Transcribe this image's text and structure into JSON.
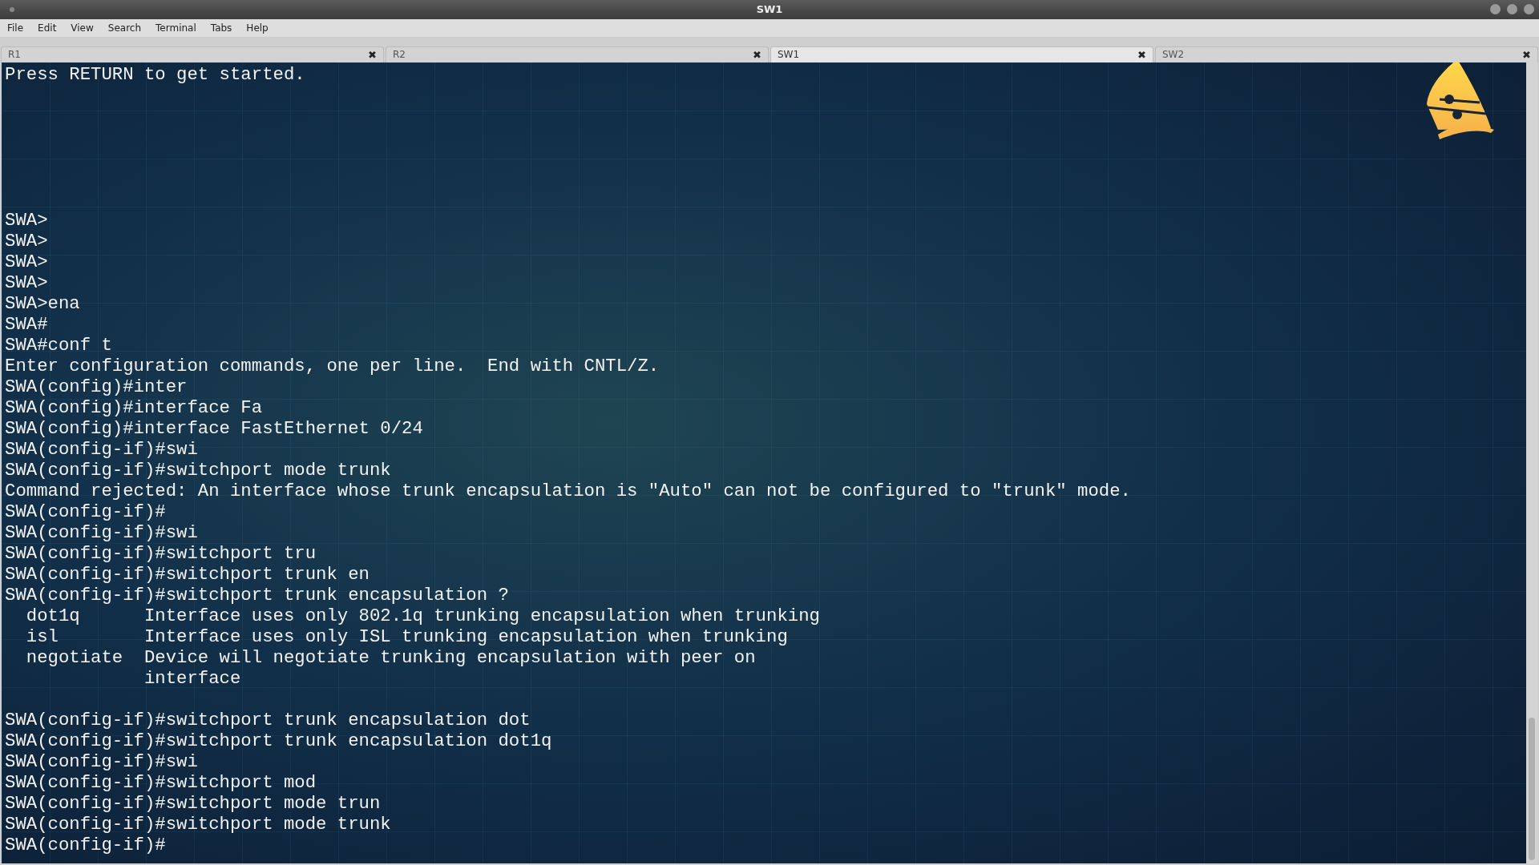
{
  "window": {
    "title": "SW1"
  },
  "menu": [
    "File",
    "Edit",
    "View",
    "Search",
    "Terminal",
    "Tabs",
    "Help"
  ],
  "tabs": [
    {
      "label": "R1",
      "selected": false,
      "close": "✖"
    },
    {
      "label": "R2",
      "selected": false,
      "close": "✖"
    },
    {
      "label": "SW1",
      "selected": true,
      "close": "✖"
    },
    {
      "label": "SW2",
      "selected": false,
      "close": "✖"
    }
  ],
  "terminal": {
    "blocks": [
      [
        "Press RETURN to get started."
      ],
      [
        "SWA>",
        "SWA>",
        "SWA>",
        "SWA>",
        "SWA>ena",
        "SWA#",
        "SWA#conf t",
        "Enter configuration commands, one per line.  End with CNTL/Z.",
        "SWA(config)#inter",
        "SWA(config)#interface Fa",
        "SWA(config)#interface FastEthernet 0/24",
        "SWA(config-if)#swi",
        "SWA(config-if)#switchport mode trunk",
        "Command rejected: An interface whose trunk encapsulation is \"Auto\" can not be configured to \"trunk\" mode.",
        "SWA(config-if)#",
        "SWA(config-if)#swi",
        "SWA(config-if)#switchport tru",
        "SWA(config-if)#switchport trunk en",
        "SWA(config-if)#switchport trunk encapsulation ?",
        "  dot1q      Interface uses only 802.1q trunking encapsulation when trunking",
        "  isl        Interface uses only ISL trunking encapsulation when trunking",
        "  negotiate  Device will negotiate trunking encapsulation with peer on",
        "             interface"
      ],
      [
        "SWA(config-if)#switchport trunk encapsulation dot",
        "SWA(config-if)#switchport trunk encapsulation dot1q",
        "SWA(config-if)#swi",
        "SWA(config-if)#switchport mod",
        "SWA(config-if)#switchport mode trun",
        "SWA(config-if)#switchport mode trunk",
        "SWA(config-if)#"
      ]
    ]
  }
}
